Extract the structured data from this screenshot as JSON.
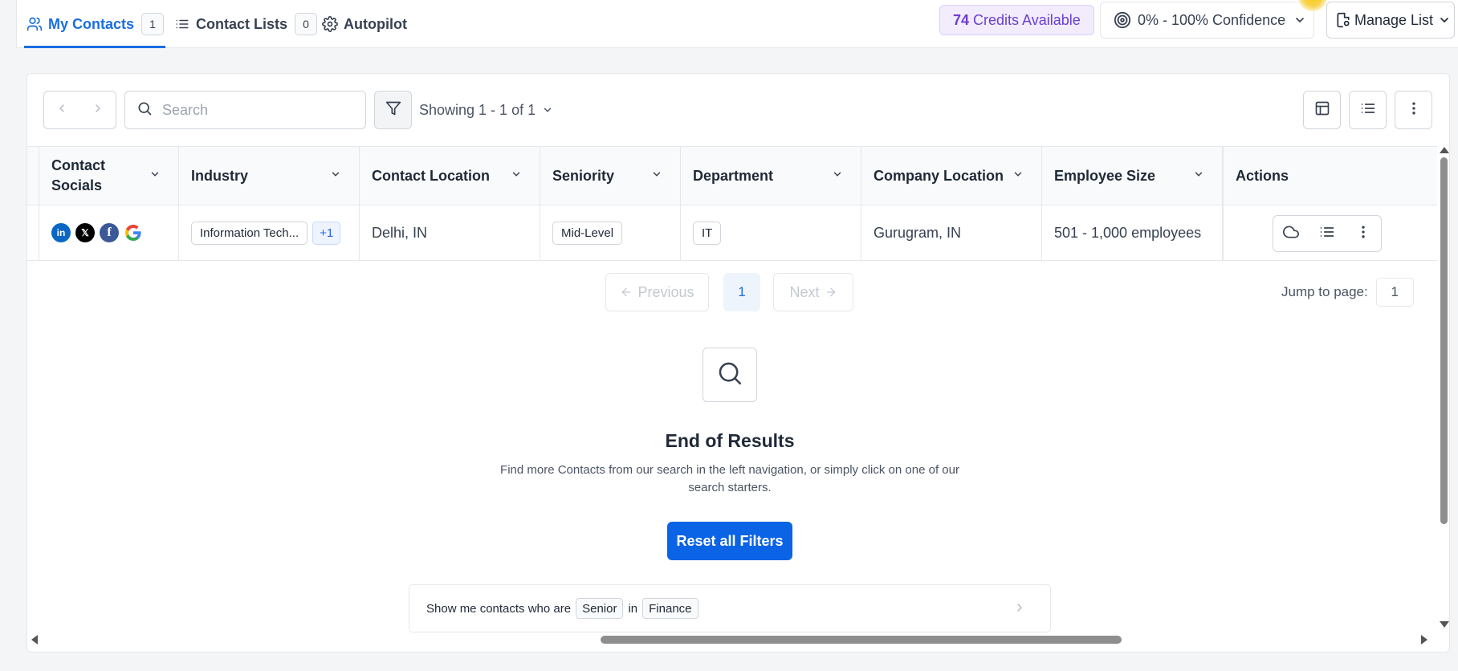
{
  "tabs": [
    {
      "label": "My Contacts",
      "count": "1",
      "icon": "users-icon"
    },
    {
      "label": "Contact Lists",
      "count": "0",
      "icon": "list-icon"
    },
    {
      "label": "Autopilot",
      "icon": "gear-icon"
    }
  ],
  "credits": {
    "amount": "74",
    "label": "Credits Available"
  },
  "confidence": {
    "label": "0% - 100% Confidence",
    "icon": "target-icon"
  },
  "manage_list": {
    "label": "Manage List",
    "icon": "clipboard-gear-icon"
  },
  "toolbar": {
    "search_placeholder": "Search",
    "showing": "Showing 1 - 1 of 1"
  },
  "table": {
    "columns": [
      "Contact Socials",
      "Industry",
      "Contact Location",
      "Seniority",
      "Department",
      "Company Location",
      "Employee Size",
      "Actions"
    ],
    "rows": [
      {
        "socials": [
          "linkedin-icon",
          "x-icon",
          "facebook-icon",
          "google-icon"
        ],
        "industry": "Information Tech...",
        "industry_more": "+1",
        "contact_location": "Delhi, IN",
        "seniority": "Mid-Level",
        "department": "IT",
        "company_location": "Gurugram, IN",
        "employee_size": "501 - 1,000 employees"
      }
    ]
  },
  "pagination": {
    "previous": "Previous",
    "current_page": "1",
    "next": "Next",
    "jump_label": "Jump to page:",
    "jump_value": "1"
  },
  "empty_state": {
    "title": "End of Results",
    "description": "Find more Contacts from our search in the left navigation, or simply click on one of our search starters.",
    "reset_button": "Reset all Filters"
  },
  "starter": {
    "prefix": "Show me contacts who are",
    "seniority": "Senior",
    "connector": "in",
    "department": "Finance"
  },
  "colors": {
    "accent": "#1a6ee3",
    "primary_button": "#0b63e5",
    "credits_text": "#6b3fd1"
  }
}
